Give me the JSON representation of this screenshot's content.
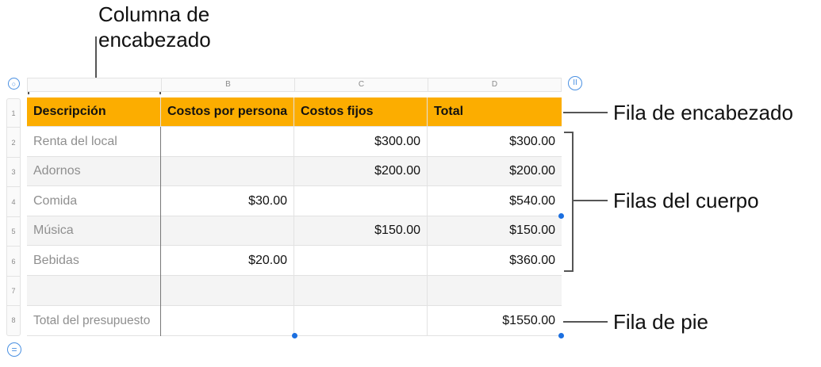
{
  "callouts": {
    "header_column": [
      "Columna de",
      "encabezado"
    ],
    "header_row": "Fila de encabezado",
    "body_rows": "Filas del cuerpo",
    "footer_row": "Fila de pie"
  },
  "column_letters": [
    "B",
    "C",
    "D"
  ],
  "row_numbers": [
    "1",
    "2",
    "3",
    "4",
    "5",
    "6",
    "7",
    "8"
  ],
  "table": {
    "headers": [
      "Descripción",
      "Costos por persona",
      "Costos fijos",
      "Total"
    ],
    "rows": [
      [
        "Renta del local",
        "",
        "$300.00",
        "$300.00"
      ],
      [
        "Adornos",
        "",
        "$200.00",
        "$200.00"
      ],
      [
        "Comida",
        "$30.00",
        "",
        "$540.00"
      ],
      [
        "Música",
        "",
        "$150.00",
        "$150.00"
      ],
      [
        "Bebidas",
        "$20.00",
        "",
        "$360.00"
      ],
      [
        "",
        "",
        "",
        ""
      ],
      [
        "Total del presupuesto",
        "",
        "",
        "$1550.00"
      ]
    ]
  },
  "colors": {
    "header_fill": "#fcad00",
    "handle_blue": "#1b6fe0"
  },
  "handles": {
    "top_left_icon": "circle-handle-icon",
    "top_right_icon": "pause-handle-icon",
    "bottom_left_icon": "equals-handle-icon"
  }
}
